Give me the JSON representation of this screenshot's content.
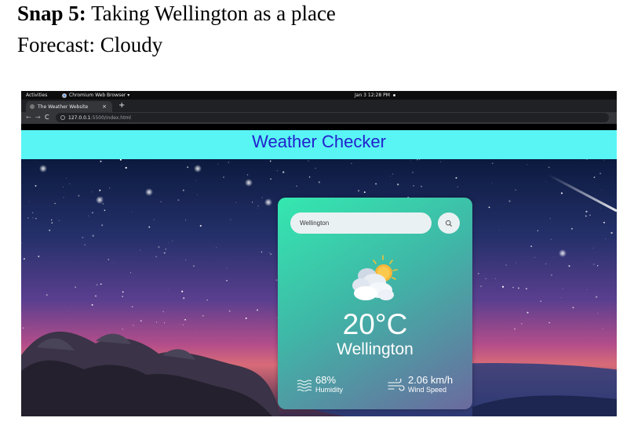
{
  "caption": {
    "snap_label": "Snap 5:",
    "snap_text": "Taking Wellington as a place",
    "forecast": "Forecast: Cloudy"
  },
  "os_bar": {
    "activities": "Activities",
    "app_name": "Chromium Web Browser ▾",
    "clock": "Jan 3  12:28 PM"
  },
  "browser": {
    "tab_title": "The Weather Website",
    "tab_close": "×",
    "new_tab": "+",
    "url_host": "127.0.0.1",
    "url_path": ":5500/index.html"
  },
  "page": {
    "heading": "Weather Checker",
    "search_value": "Wellington",
    "weather_icon": "partly-cloudy-icon",
    "temperature": "20°C",
    "city": "Wellington",
    "humidity_value": "68%",
    "humidity_label": "Humidity",
    "wind_value": "2.06 km/h",
    "wind_label": "Wind Speed"
  },
  "colors": {
    "header_bg": "#59f5f5",
    "heading_text": "#2222cc",
    "card_top": "#34e8b0",
    "card_bottom": "#6b6a9e"
  }
}
